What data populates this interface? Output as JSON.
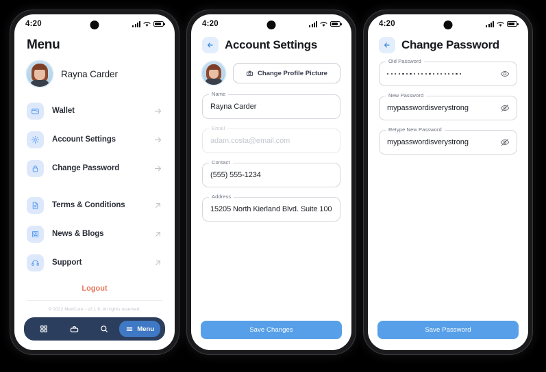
{
  "colors": {
    "accent_blue": "#579fe8",
    "icon_blue": "#5b9cf5",
    "icon_bg": "#dde9fb",
    "nav_bg": "#2c3e5d",
    "nav_pill": "#3f78c4",
    "logout_red": "#e8755c",
    "frame": "#1b1b1d"
  },
  "status_bar": {
    "time": "4:20",
    "signal_icon": "signal-bars-icon",
    "wifi_icon": "wifi-icon",
    "battery_icon": "battery-icon"
  },
  "phone1": {
    "title": "Menu",
    "profile": {
      "name": "Rayna Carder",
      "avatar_icon": "user-avatar"
    },
    "menu_items": [
      {
        "label": "Wallet",
        "icon": "wallet-icon",
        "arrow": "arrow-right-icon"
      },
      {
        "label": "Account Settings",
        "icon": "gear-icon",
        "arrow": "arrow-right-icon"
      },
      {
        "label": "Change Password",
        "icon": "lock-icon",
        "arrow": "arrow-right-icon"
      }
    ],
    "link_items": [
      {
        "label": "Terms & Conditions",
        "icon": "document-icon",
        "arrow": "external-link-icon"
      },
      {
        "label": "News & Blogs",
        "icon": "newspaper-icon",
        "arrow": "external-link-icon"
      },
      {
        "label": "Support",
        "icon": "headset-icon",
        "arrow": "external-link-icon"
      }
    ],
    "logout_label": "Logout",
    "copyright": "© 2022 MedCure - v2.1.6. All rights reserved.",
    "bottom_nav": {
      "items": [
        {
          "icon": "grid-icon",
          "label": ""
        },
        {
          "icon": "briefcase-icon",
          "label": ""
        },
        {
          "icon": "search-icon",
          "label": ""
        }
      ],
      "active": {
        "icon": "hamburger-icon",
        "label": "Menu"
      }
    }
  },
  "phone2": {
    "back_icon": "arrow-left-icon",
    "title": "Account Settings",
    "avatar_icon": "user-avatar",
    "change_picture": {
      "label": "Change Profile Picture",
      "icon": "camera-icon"
    },
    "fields": [
      {
        "label": "Name",
        "value": "Rayna Carder",
        "disabled": false
      },
      {
        "label": "Email",
        "value": "adam.costa@email.com",
        "disabled": true
      },
      {
        "label": "Contact",
        "value": "(555) 555-1234",
        "disabled": false
      },
      {
        "label": "Address",
        "value": "15205 North Kierland Blvd. Suite 100",
        "disabled": false
      }
    ],
    "save_label": "Save Changes"
  },
  "phone3": {
    "back_icon": "arrow-left-icon",
    "title": "Change Password",
    "fields": [
      {
        "label": "Old Password",
        "value": "",
        "masked": true,
        "mask_count": 20,
        "eye": "eye-icon"
      },
      {
        "label": "New Password",
        "value": "mypasswordisverystrong",
        "masked": false,
        "eye": "eye-off-icon"
      },
      {
        "label": "Retype New Password",
        "value": "mypasswordisverystrong",
        "masked": false,
        "eye": "eye-off-icon"
      }
    ],
    "save_label": "Save Password"
  }
}
